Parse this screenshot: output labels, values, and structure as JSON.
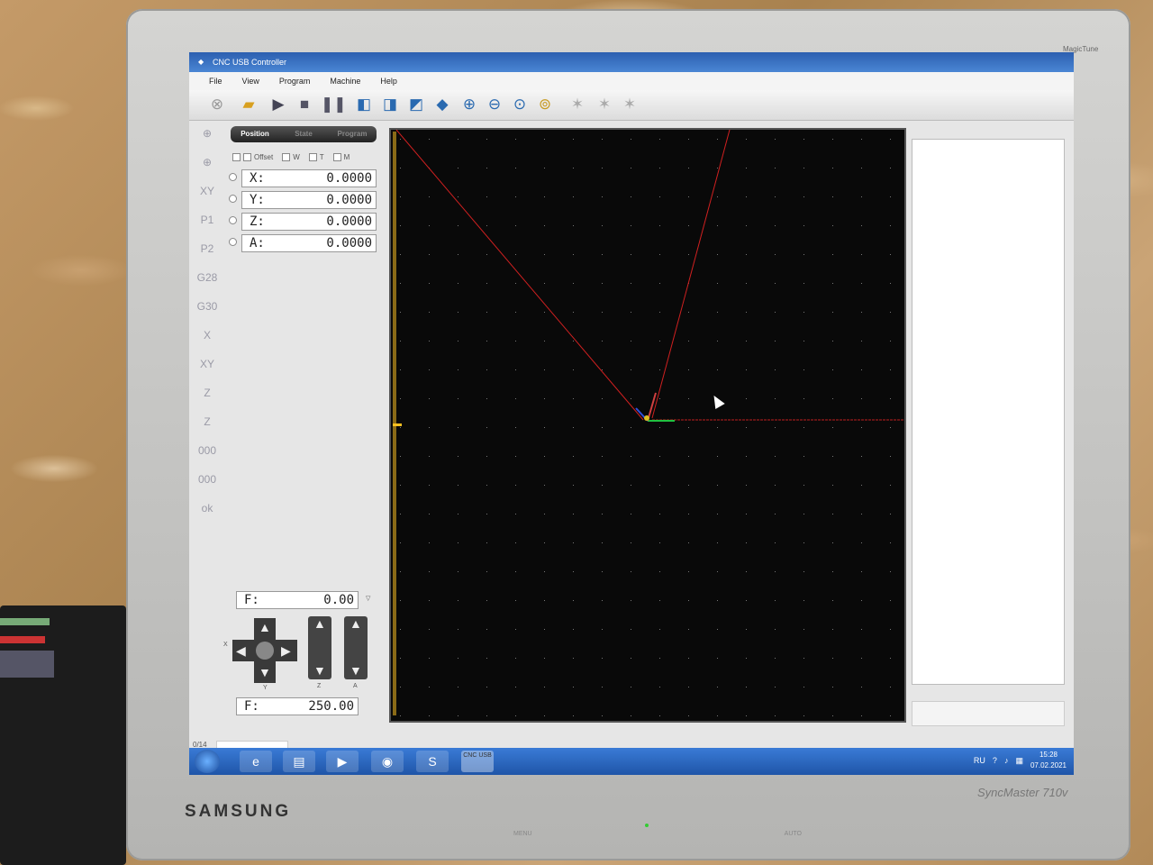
{
  "window": {
    "title": "CNC USB Controller",
    "buttons": [
      "—",
      "▭",
      "✕"
    ]
  },
  "menu": {
    "items": [
      "File",
      "View",
      "Program",
      "Machine",
      "Help"
    ]
  },
  "toolbar": {
    "icons": [
      "stop-circle-icon",
      "open-folder-icon",
      "play-icon",
      "stop-icon",
      "pause-icon",
      "view-iso-icon",
      "view-front-icon",
      "view-side-icon",
      "view-3d-icon",
      "zoom-in-icon",
      "zoom-out-icon",
      "zoom-fit-icon",
      "zoom-window-icon",
      "tool-1-icon",
      "tool-2-icon",
      "tool-3-icon"
    ]
  },
  "side_strip": {
    "items": [
      "⊕",
      "⊕",
      "XY",
      "P1",
      "P2",
      "G28",
      "G30",
      "X",
      "XY",
      "Z",
      "Z",
      "000",
      "000",
      "ok"
    ]
  },
  "tabs": {
    "position": "Position",
    "state": "State",
    "program": "Program",
    "active": "Position"
  },
  "checks": {
    "offset": "Offset",
    "w": "W",
    "t": "T",
    "m": "M"
  },
  "coords": [
    {
      "label": "X:",
      "value": "0.0000"
    },
    {
      "label": "Y:",
      "value": "0.0000"
    },
    {
      "label": "Z:",
      "value": "0.0000"
    },
    {
      "label": "A:",
      "value": "0.0000"
    }
  ],
  "feed": {
    "current_label": "F:",
    "current_value": "0.00",
    "jog_label": "F:",
    "jog_value": "250.00"
  },
  "jog": {
    "x_label": "X",
    "y_label": "Y",
    "z_label": "Z",
    "a_label": "A"
  },
  "status": {
    "progress": "0/14"
  },
  "taskbar": {
    "lang": "RU",
    "time": "15:28",
    "date": "07.02.2021",
    "cnc_label": "CNC USB"
  },
  "monitor": {
    "brand": "SAMSUNG",
    "model": "SyncMaster 710v",
    "tag": "MagicTune",
    "menu": "MENU",
    "auto": "AUTO"
  },
  "colors": {
    "viewport_bg": "#090909",
    "path_red": "#d02020",
    "axis_green": "#20c040",
    "title_blue": "#2c5fb0"
  }
}
